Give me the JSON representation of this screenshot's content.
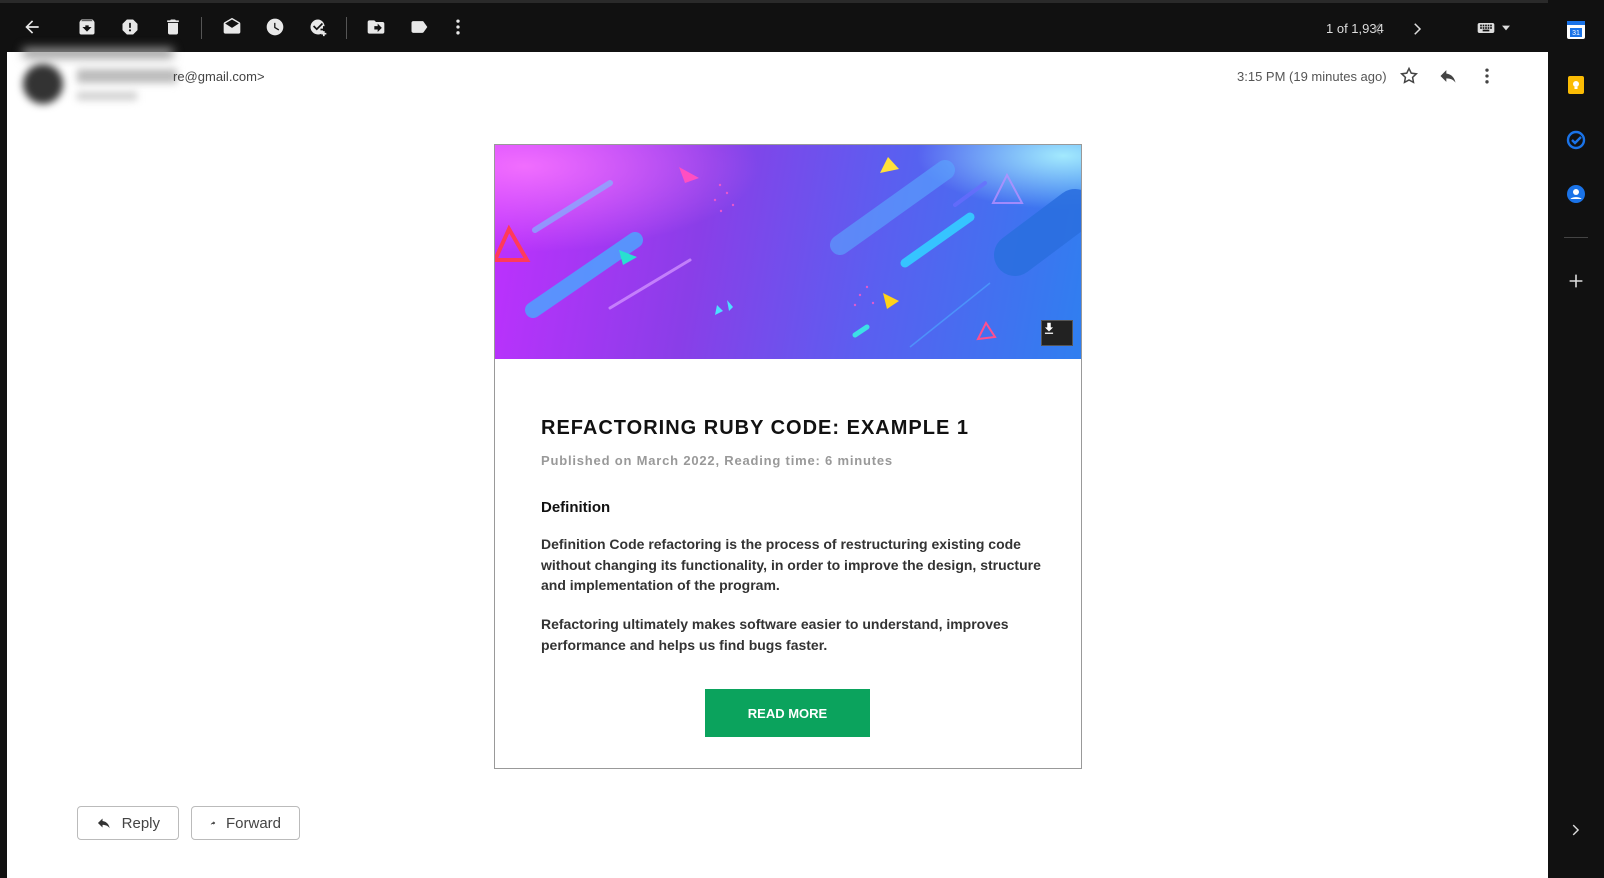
{
  "toolbar": {
    "count": "1 of 1,934",
    "icons": [
      "back-arrow-icon",
      "archive-icon",
      "report-spam-icon",
      "delete-icon",
      "mark-unread-icon",
      "snooze-icon",
      "add-task-icon",
      "move-to-icon",
      "label-icon",
      "more-vert-icon"
    ]
  },
  "header": {
    "sender_email": "re@gmail.com>",
    "timestamp": "3:15 PM (19 minutes ago)"
  },
  "email": {
    "title": "REFACTORING RUBY CODE: EXAMPLE 1",
    "meta": "Published on March 2022, Reading time: 6 minutes",
    "definition_heading": "Definition",
    "paragraph1": "Definition Code refactoring is the process of restructuring existing code without changing its functionality, in order to improve the design, structure and implementation of the program.",
    "paragraph2": "Refactoring ultimately makes software easier to understand, improves performance and helps us find bugs faster.",
    "cta_label": "READ MORE"
  },
  "actions": {
    "reply_label": "Reply",
    "forward_label": "Forward"
  },
  "colors": {
    "cta": "#0ba35d",
    "banner_start": "#c030ff",
    "banner_end": "#2f7ff0"
  }
}
